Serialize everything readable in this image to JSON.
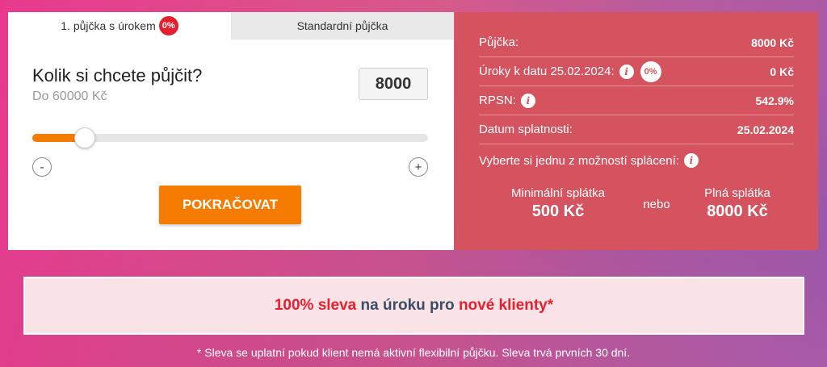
{
  "tabs": [
    {
      "label": "1. půjčka s úrokem",
      "badge": "0%"
    },
    {
      "label": "Standardní půjčka"
    }
  ],
  "calculator": {
    "question": "Kolik si chcete půjčit?",
    "max_hint": "Do 60000 Kč",
    "amount": "8000",
    "slider": {
      "min": 0,
      "max": 60000,
      "value": 8000
    },
    "minus_label": "-",
    "plus_label": "+",
    "cta_label": "POKRAČOVAT"
  },
  "summary": {
    "loan_label": "Půjčka:",
    "loan_value": "8000 Kč",
    "interest_label": "Úroky k datu 25.02.2024:",
    "interest_badge": "0%",
    "interest_value": "0 Kč",
    "rpsn_label": "RPSN:",
    "rpsn_value": "542.9%",
    "due_label": "Datum splatnosti:",
    "due_value": "25.02.2024",
    "choose_label": "Vyberte si jednu z možností splácení:",
    "min_label": "Minimální splátka",
    "min_value": "500 Kč",
    "or_label": "nebo",
    "full_label": "Plná splátka",
    "full_value": "8000 Kč"
  },
  "banner": {
    "part1": "100% sleva",
    "part2": " na úroku pro ",
    "part3": "nové klienty*"
  },
  "footnote": "* Sleva se uplatní pokud klient nemá aktivní flexibilní půjčku. Sleva trvá prvních 30 dní.",
  "colors": {
    "accent_orange": "#f57c00",
    "summary_bg": "#d4535f",
    "badge_red": "#e5202e",
    "banner_text": "#3b4d66"
  },
  "icons": [
    "info-icon"
  ]
}
